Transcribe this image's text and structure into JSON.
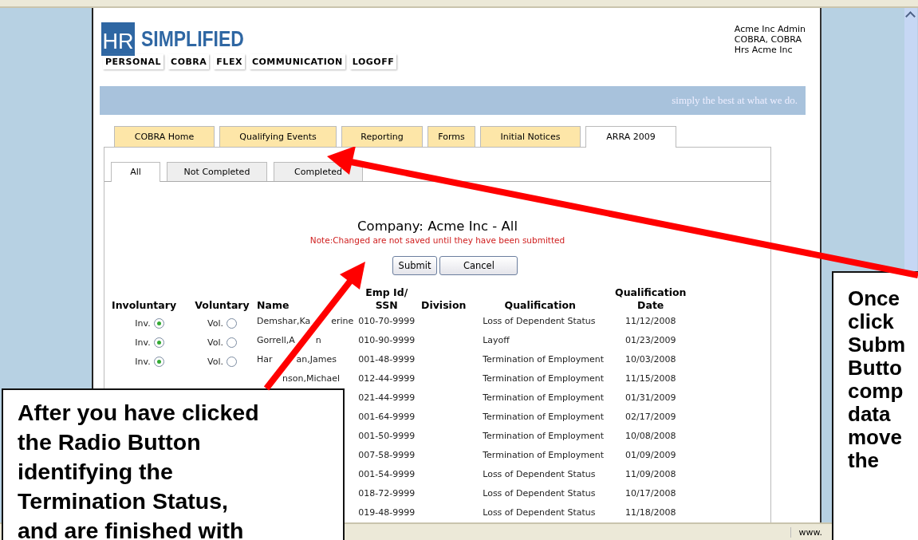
{
  "logo": {
    "mark": "HR",
    "name": "SIMPLIFIED"
  },
  "nav": [
    "PERSONAL",
    "COBRA",
    "FLEX",
    "COMMUNICATION",
    "LOGOFF"
  ],
  "user": [
    "Acme Inc Admin",
    "COBRA, COBRA",
    "Hrs Acme Inc"
  ],
  "banner": "simply the best at what we do.",
  "tabs": [
    {
      "label": "COBRA Home",
      "selected": false
    },
    {
      "label": "Qualifying Events",
      "selected": false
    },
    {
      "label": "Reporting",
      "selected": false
    },
    {
      "label": "Forms",
      "selected": false
    },
    {
      "label": "Initial Notices",
      "selected": false
    },
    {
      "label": "ARRA 2009",
      "selected": true
    }
  ],
  "subtabs": [
    {
      "label": "All",
      "selected": true
    },
    {
      "label": "Not Completed",
      "selected": false
    },
    {
      "label": "Completed",
      "selected": false
    }
  ],
  "title": "Company: Acme Inc - All",
  "note": "Note:Changed are not saved until they have been submitted",
  "buttons": [
    "Submit",
    "Cancel"
  ],
  "columns": [
    "Involuntary",
    "Voluntary",
    "Name",
    "Emp Id/ SSN",
    "Division",
    "Qualification",
    "Qualification Date"
  ],
  "rows": [
    {
      "involuntary": {
        "label": "Inv.",
        "checked": true
      },
      "voluntary": {
        "label": "Vol.",
        "checked": false
      },
      "name": [
        "Demshar,Ka",
        "erine"
      ],
      "ssn": "010-70-9999",
      "qualification": "Loss of Dependent Status",
      "date": "11/12/2008"
    },
    {
      "involuntary": {
        "label": "Inv.",
        "checked": true
      },
      "voluntary": {
        "label": "Vol.",
        "checked": false
      },
      "name": [
        "Gorrell,A",
        "n"
      ],
      "ssn": "010-90-9999",
      "qualification": "Layoff",
      "date": "01/23/2009"
    },
    {
      "involuntary": {
        "label": "Inv.",
        "checked": true
      },
      "voluntary": {
        "label": "Vol.",
        "checked": false
      },
      "name": [
        "Har",
        "an,James"
      ],
      "ssn": "001-48-9999",
      "qualification": "Termination of Employment",
      "date": "10/03/2008"
    },
    {
      "name": [
        "nson,Michael"
      ],
      "ssn": "012-44-9999",
      "qualification": "Termination of Employment",
      "date": "11/15/2008"
    },
    {
      "ssn": "021-44-9999",
      "qualification": "Termination of Employment",
      "date": "01/31/2009"
    },
    {
      "ssn": "001-64-9999",
      "qualification": "Termination of Employment",
      "date": "02/17/2009"
    },
    {
      "ssn": "001-50-9999",
      "qualification": "Termination of Employment",
      "date": "10/08/2008"
    },
    {
      "ssn": "007-58-9999",
      "qualification": "Termination of Employment",
      "date": "01/09/2009"
    },
    {
      "ssn": "001-54-9999",
      "qualification": "Loss of Dependent Status",
      "date": "11/09/2008"
    },
    {
      "ssn": "018-72-9999",
      "qualification": "Loss of Dependent Status",
      "date": "10/17/2008"
    },
    {
      "ssn": "019-48-9999",
      "qualification": "Loss of Dependent Status",
      "date": "11/18/2008"
    }
  ],
  "status_bar": {
    "url": "www."
  },
  "callout_left": [
    "After you have clicked",
    "the Radio Button",
    "identifying the",
    "Termination Status,",
    "and are finished with"
  ],
  "callout_right": [
    "Once",
    "click",
    "Subm",
    "Butto",
    "comp",
    "data",
    "move",
    "the"
  ]
}
